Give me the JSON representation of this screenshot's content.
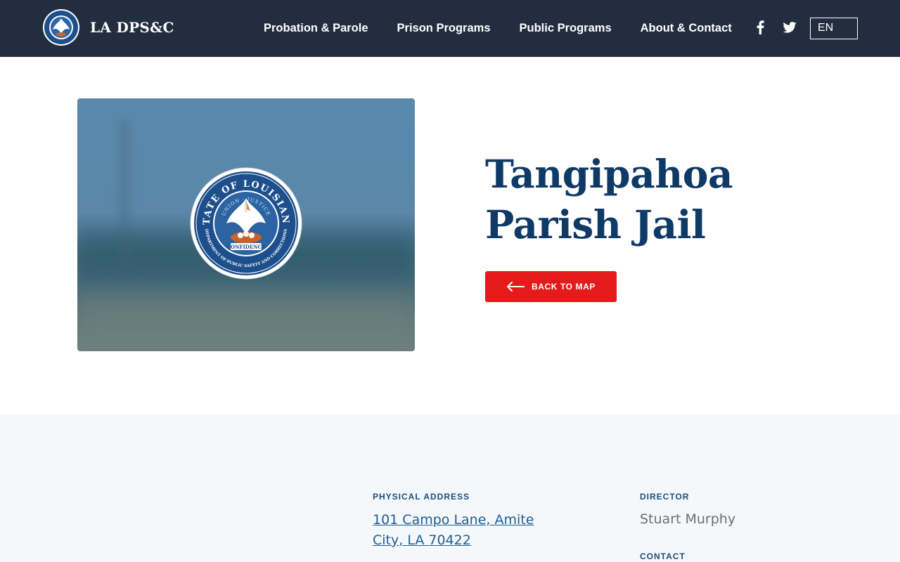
{
  "header": {
    "brand_name": "LA DPS&C",
    "nav": [
      {
        "label": "Probation & Parole"
      },
      {
        "label": "Prison Programs"
      },
      {
        "label": "Public Programs"
      },
      {
        "label": "About & Contact"
      }
    ],
    "social": [
      "facebook-icon",
      "twitter-icon"
    ],
    "language": "EN"
  },
  "hero": {
    "title_line1": "Tangipahoa",
    "title_line2": "Parish Jail",
    "back_button_label": "BACK TO MAP",
    "seal_text": {
      "top": "STATE OF LOUISIANA",
      "motto": "UNION · JUSTICE",
      "bottom": "CONFIDENCE",
      "ring": "DEPARTMENT OF PUBLIC SAFETY AND CORRECTIONS"
    }
  },
  "details": {
    "address_label": "PHYSICAL ADDRESS",
    "address_line1": "101 Campo Lane, Amite",
    "address_line2": "City, LA 70422",
    "director_label": "DIRECTOR",
    "director_name": "Stuart Murphy",
    "contact_label": "CONTACT"
  },
  "colors": {
    "header_bg": "#222e40",
    "title": "#103a66",
    "button": "#e51a1a",
    "details_bg": "#f5f8fb",
    "link": "#1d5e95"
  }
}
